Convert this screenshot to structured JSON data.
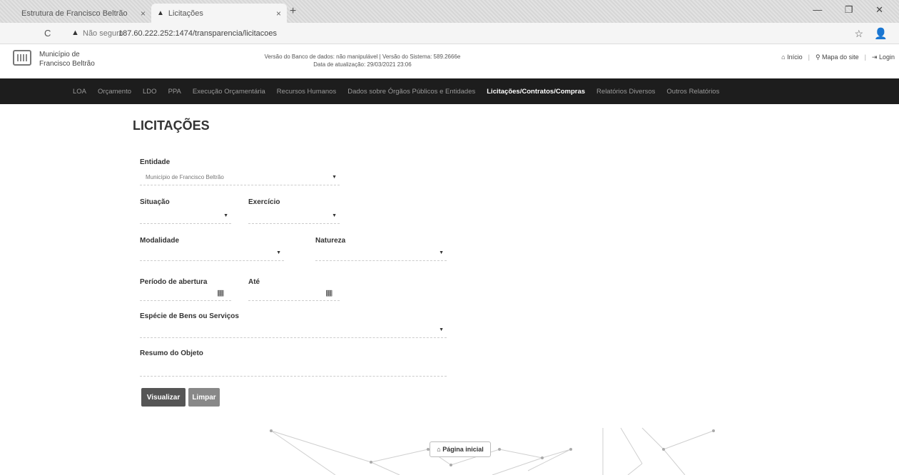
{
  "browser": {
    "tabs": [
      {
        "title": "Estrutura de Francisco Beltrão",
        "close": "×"
      },
      {
        "title": "Licitações",
        "close": "×"
      }
    ],
    "new_tab": "+",
    "window_controls": "— ❐ ✕",
    "nav": "← →  C",
    "security_text": "Não seguro",
    "url": "187.60.222.252:1474/transparencia/licitacoes"
  },
  "site": {
    "org_line1": "Município de",
    "org_line2": "Francisco Beltrão",
    "db_info_line1": "Versão do Banco de dados: não manipulável  |  Versão do Sistema: 589.2666e",
    "db_info_line2": "Data de atualização: 29/03/2021 23:06",
    "top_links": [
      "Início",
      "Mapa do site",
      "Login"
    ]
  },
  "nav": {
    "items": [
      {
        "label": "LOA"
      },
      {
        "label": "Orçamento"
      },
      {
        "label": "LDO"
      },
      {
        "label": "PPA"
      },
      {
        "label": "Execução Orçamentária"
      },
      {
        "label": "Recursos Humanos"
      },
      {
        "label": "Dados sobre Órgãos Públicos e Entidades"
      },
      {
        "label": "Licitações/Contratos/Compras"
      },
      {
        "label": "Relatórios Diversos"
      },
      {
        "label": "Outros Relatórios"
      }
    ],
    "active_index": 7
  },
  "page": {
    "title": "LICITAÇÕES",
    "form": {
      "entidade_label": "Entidade",
      "entidade_value": "Município de Francisco Beltrão",
      "situacao_label": "Situação",
      "exercicio_label": "Exercício",
      "modalidade_label": "Modalidade",
      "natureza_label": "Natureza",
      "periodo_label": "Período de abertura",
      "ate_label": "Até",
      "especie_label": "Espécie de Bens ou Serviços",
      "resumo_label": "Resumo do Objeto",
      "visualizar_label": "Visualizar",
      "limpar_label": "Limpar"
    },
    "main_page_link": "Página inicial"
  }
}
